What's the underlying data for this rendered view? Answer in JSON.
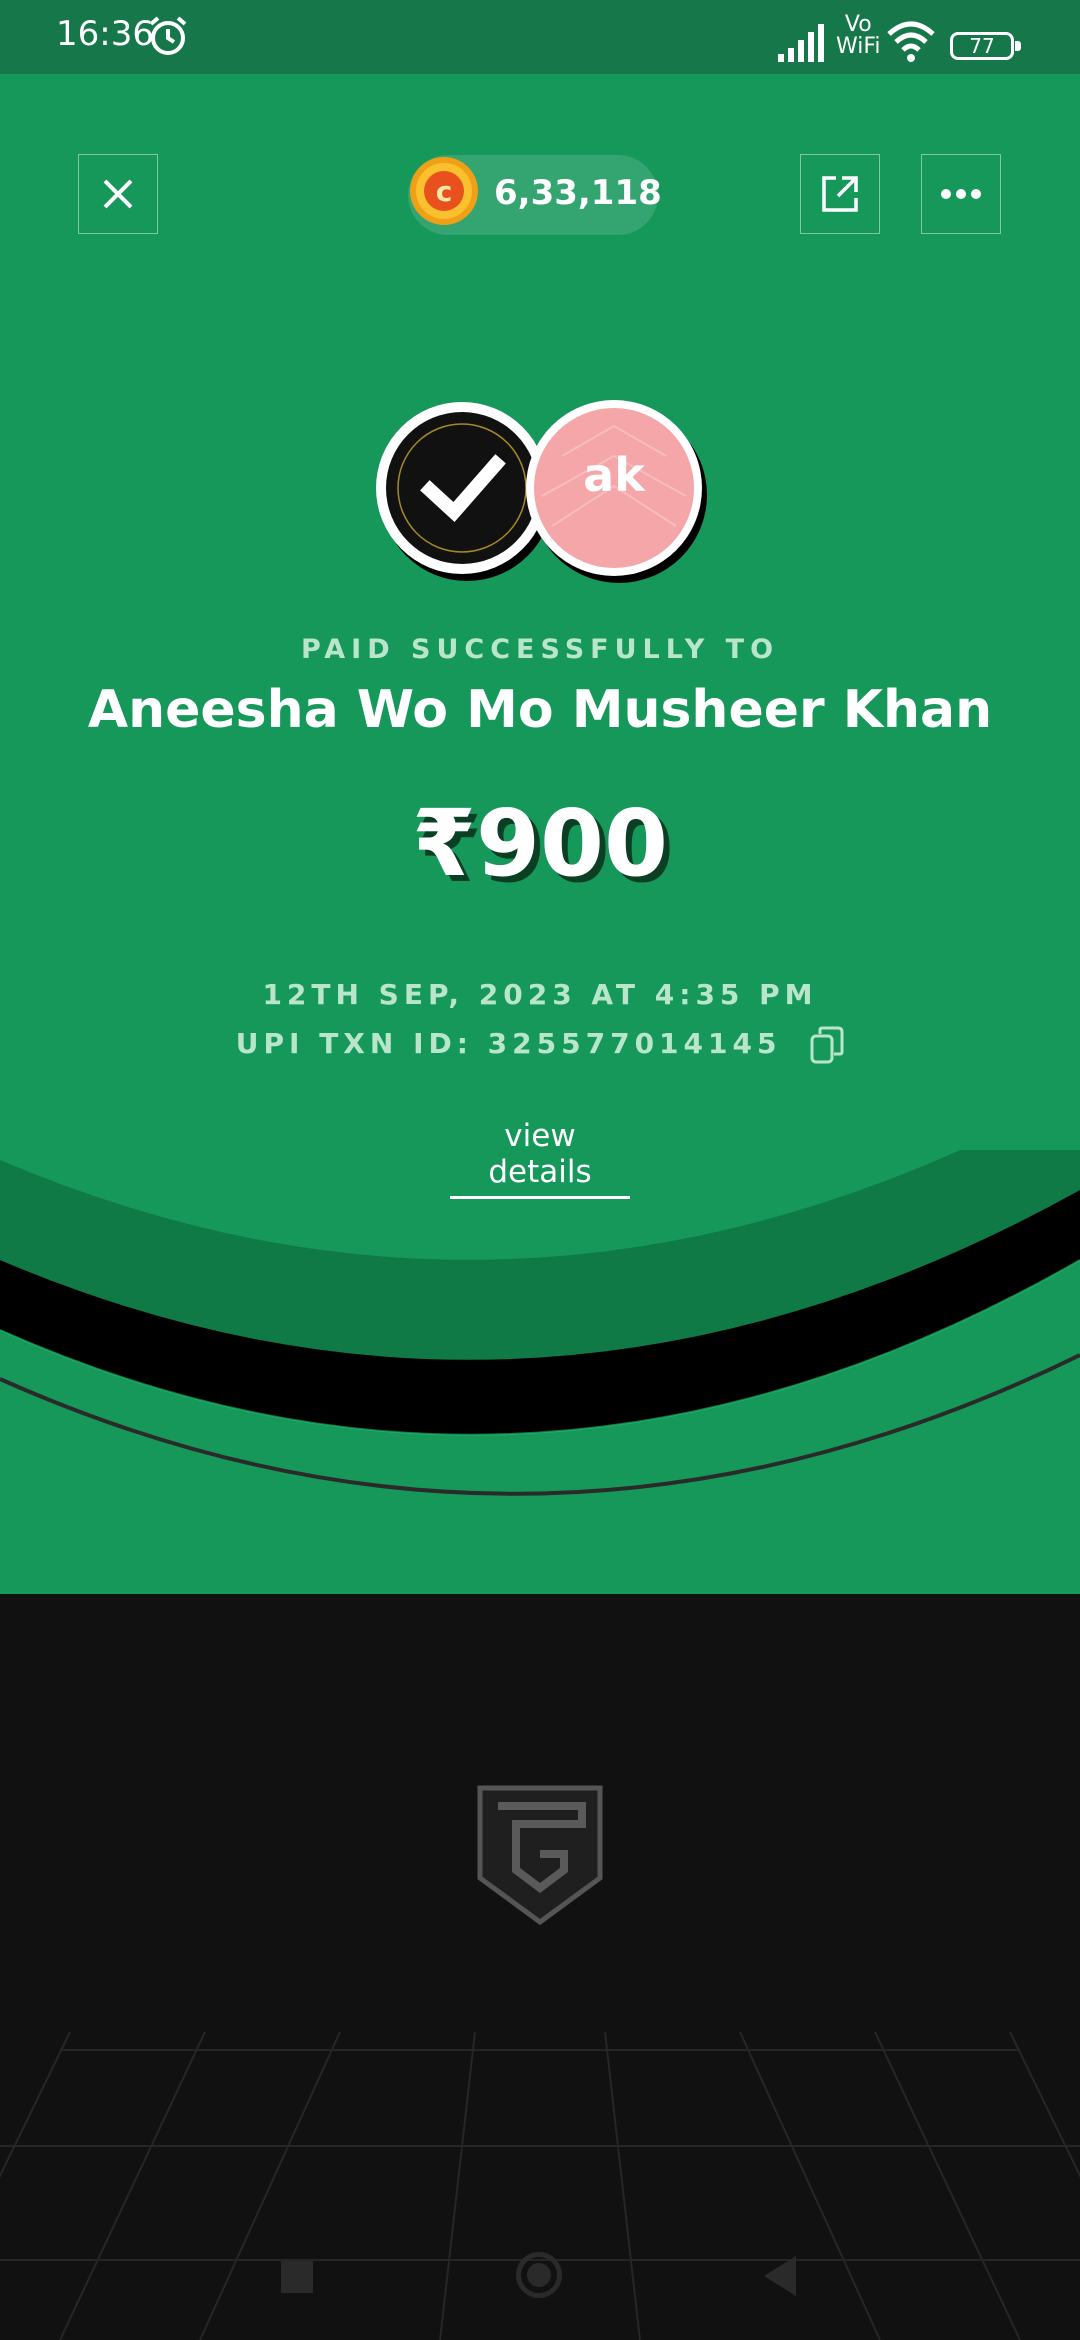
{
  "status_bar": {
    "time": "16:36",
    "vowifi_line1": "Vo",
    "vowifi_line2": "WiFi",
    "battery": "77"
  },
  "header": {
    "coins": "6,33,118",
    "close_icon": "close-icon",
    "share_icon": "external-share-icon",
    "more_icon": "more-dots-icon"
  },
  "payee": {
    "initials": "ak",
    "label": "PAID SUCCESSFULLY TO",
    "name": "Aneesha Wo Mo Musheer Khan"
  },
  "payment": {
    "amount": "₹900",
    "datetime": "12TH SEP, 2023 AT 4:35 PM",
    "txn_id": "UPI TXN ID: 325577014145",
    "view_details": "view details"
  },
  "colors": {
    "hero_green": "#16985b",
    "status_green": "#16784a",
    "dark_bg": "#111111",
    "avatar_pink": "#f5a6a8"
  }
}
